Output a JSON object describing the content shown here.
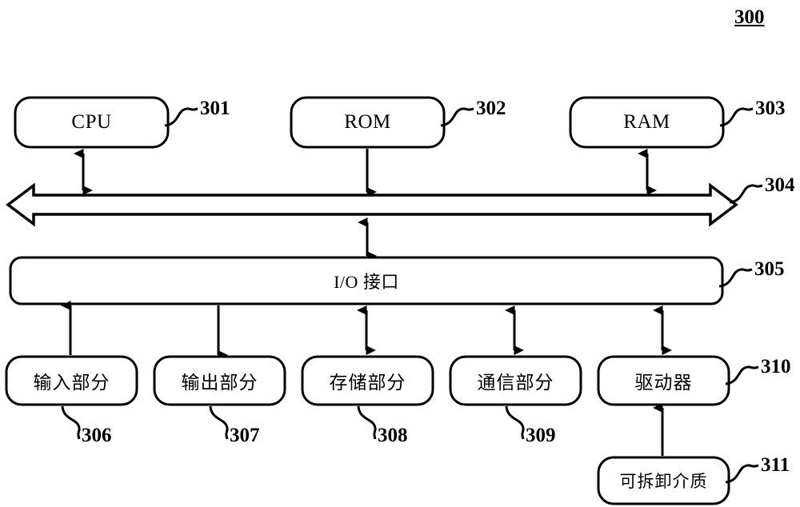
{
  "figure": {
    "number": "300",
    "diagram_type": "computer-system-block-diagram",
    "line_color": "#000000",
    "fill_color": "#ffffff"
  },
  "nodes": {
    "cpu": {
      "label": "CPU",
      "ref": "301"
    },
    "rom": {
      "label": "ROM",
      "ref": "302"
    },
    "ram": {
      "label": "RAM",
      "ref": "303"
    },
    "bus": {
      "label": "",
      "ref": "304"
    },
    "io_interface": {
      "label": "I/O 接口",
      "ref": "305"
    },
    "input_part": {
      "label": "输入部分",
      "ref": "306"
    },
    "output_part": {
      "label": "输出部分",
      "ref": "307"
    },
    "storage_part": {
      "label": "存储部分",
      "ref": "308"
    },
    "comm_part": {
      "label": "通信部分",
      "ref": "309"
    },
    "driver": {
      "label": "驱动器",
      "ref": "310"
    },
    "removable_media": {
      "label": "可拆卸介质",
      "ref": "311"
    }
  },
  "connections": [
    {
      "from": "cpu",
      "to": "bus",
      "direction": "bidirectional"
    },
    {
      "from": "rom",
      "to": "bus",
      "direction": "down"
    },
    {
      "from": "ram",
      "to": "bus",
      "direction": "bidirectional"
    },
    {
      "from": "bus",
      "to": "io_interface",
      "direction": "bidirectional"
    },
    {
      "from": "io_interface",
      "to": "input_part",
      "direction": "up"
    },
    {
      "from": "io_interface",
      "to": "output_part",
      "direction": "down"
    },
    {
      "from": "io_interface",
      "to": "storage_part",
      "direction": "bidirectional"
    },
    {
      "from": "io_interface",
      "to": "comm_part",
      "direction": "bidirectional"
    },
    {
      "from": "io_interface",
      "to": "driver",
      "direction": "bidirectional"
    },
    {
      "from": "removable_media",
      "to": "driver",
      "direction": "up"
    }
  ]
}
